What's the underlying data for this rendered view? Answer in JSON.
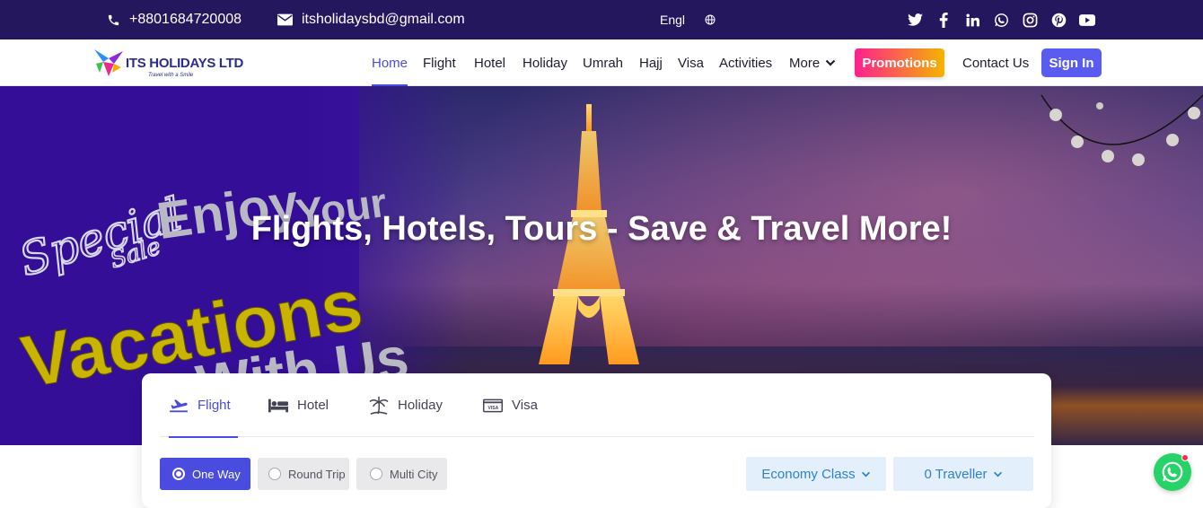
{
  "topbar": {
    "phone": "+8801684720008",
    "email": "itsholidaysbd@gmail.com",
    "language": "Engl",
    "socials": [
      "twitter-icon",
      "facebook-icon",
      "linkedin-icon",
      "whatsapp-icon",
      "instagram-icon",
      "pinterest-icon",
      "youtube-icon"
    ]
  },
  "nav": {
    "logo_text": "ITS HOLIDAYS LTD",
    "logo_tagline": "Travel with a Smile",
    "items": [
      "Home",
      "Flight",
      "Hotel",
      "Holiday",
      "Umrah",
      "Hajj",
      "Visa",
      "Activities",
      "More"
    ],
    "active": "Home",
    "promotions": "Promotions",
    "contact": "Contact Us",
    "signin": "Sign In"
  },
  "hero": {
    "title": "Flights, Hotels, Tours - Save & Travel More!",
    "promo_line1": "Special",
    "promo_line2": "Sale",
    "promo_line3": "Enjoy",
    "promo_line4": "Your",
    "promo_line5": "Vacations",
    "promo_line6": "With Us"
  },
  "search": {
    "tabs": [
      "Flight",
      "Hotel",
      "Holiday",
      "Visa"
    ],
    "active_tab": "Flight",
    "trip_types": [
      "One Way",
      "Round Trip",
      "Multi City"
    ],
    "selected_trip": "One Way",
    "cabin_class": "Economy Class",
    "travellers": "0 Traveller"
  },
  "colors": {
    "topbar": "#24175e",
    "accent": "#4a4ce0",
    "signin": "#5a5cf0",
    "dropdown_bg": "#e3f0fb",
    "dropdown_text": "#2f7fd1",
    "promo_yellow": "#c9b400",
    "whatsapp": "#25d366"
  }
}
